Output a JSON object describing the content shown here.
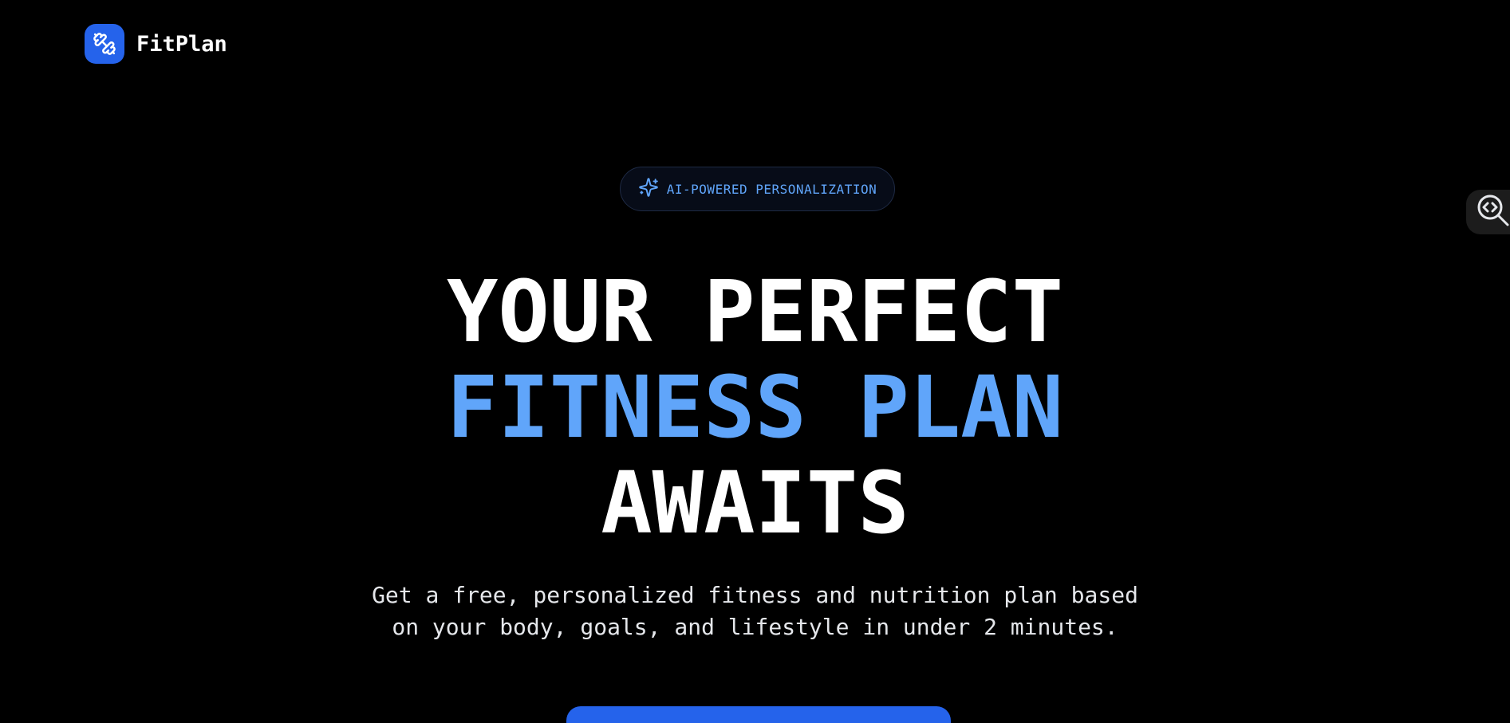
{
  "brand": {
    "name": "FitPlan",
    "logo_icon": "dumbbell-icon",
    "accent_color": "#2563eb"
  },
  "badge": {
    "icon": "sparkles-icon",
    "label": "AI-POWERED PERSONALIZATION"
  },
  "hero": {
    "line1": "YOUR PERFECT",
    "line2": "FITNESS PLAN",
    "line3": "AWAITS",
    "accent_color": "#60a5fa"
  },
  "subtitle": {
    "line1": "Get a free, personalized fitness and nutrition plan based",
    "line2": "on your body, goals, and lifestyle in under 2 minutes."
  },
  "cta": {
    "label": ""
  },
  "floating_tool": {
    "icon": "code-search-icon"
  }
}
